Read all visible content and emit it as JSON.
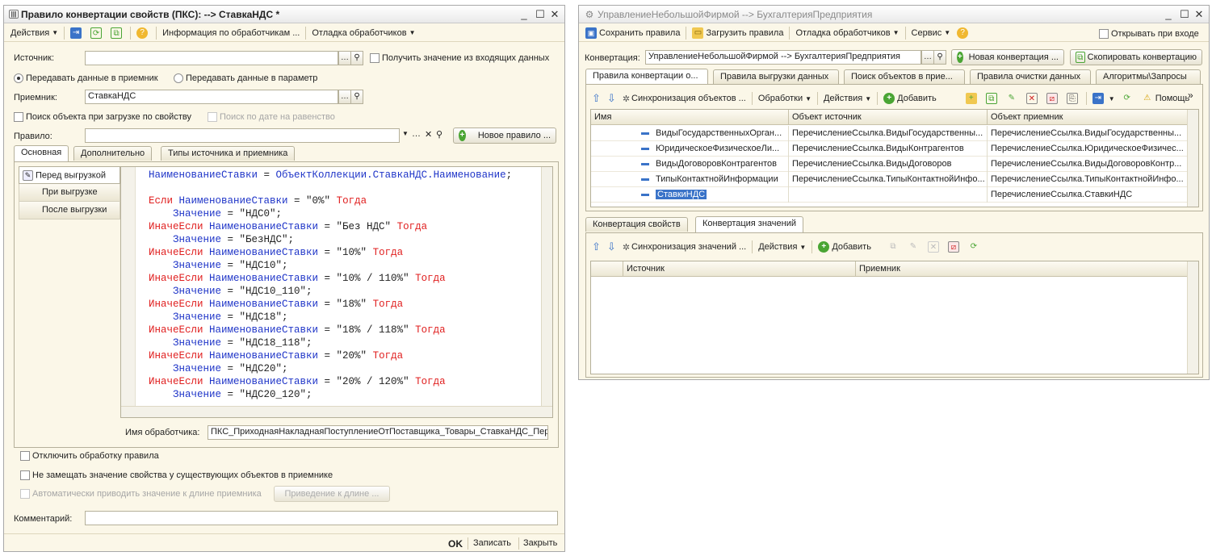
{
  "left_window": {
    "title": "Правило конвертации свойств (ПКС): --> СтавкаНДС *",
    "toolbar": {
      "actions": "Действия",
      "handlers_info": "Информация по обработчикам ...",
      "debug_handlers": "Отладка обработчиков"
    },
    "source": {
      "label": "Источник:",
      "value": ""
    },
    "get_value_incoming": "Получить значение из входящих данных",
    "radio_receiver": "Передавать данные в приемник",
    "radio_param": "Передавать данные в параметр",
    "receiver": {
      "label": "Приемник:",
      "value": "СтавкаНДС"
    },
    "search_object": "Поиск объекта при загрузке по свойству",
    "search_date": "Поиск по дате на равенство",
    "rule": {
      "label": "Правило:",
      "value": ""
    },
    "new_rule": "Новое правило ...",
    "tabs": [
      "Основная",
      "Дополнительно",
      "Типы источника и приемника"
    ],
    "handlers": [
      "Перед выгрузкой",
      "При выгрузке",
      "После выгрузки"
    ],
    "code_lines": [
      [
        {
          "t": "id",
          "v": "НаименованиеСтавки"
        },
        {
          "t": "tx",
          "v": " = "
        },
        {
          "t": "id",
          "v": "ОбъектКоллекции.СтавкаНДС.Наименование"
        },
        {
          "t": "tx",
          "v": ";"
        }
      ],
      [],
      [
        {
          "t": "kw",
          "v": "Если "
        },
        {
          "t": "id",
          "v": "НаименованиеСтавки"
        },
        {
          "t": "tx",
          "v": " = \"0%\" "
        },
        {
          "t": "kw",
          "v": "Тогда"
        }
      ],
      [
        {
          "t": "tx",
          "v": "    "
        },
        {
          "t": "id",
          "v": "Значение"
        },
        {
          "t": "tx",
          "v": " = \"НДС0\";"
        }
      ],
      [
        {
          "t": "kw",
          "v": "ИначеЕсли "
        },
        {
          "t": "id",
          "v": "НаименованиеСтавки"
        },
        {
          "t": "tx",
          "v": " = \"Без НДС\" "
        },
        {
          "t": "kw",
          "v": "Тогда"
        }
      ],
      [
        {
          "t": "tx",
          "v": "    "
        },
        {
          "t": "id",
          "v": "Значение"
        },
        {
          "t": "tx",
          "v": " = \"БезНДС\";"
        }
      ],
      [
        {
          "t": "kw",
          "v": "ИначеЕсли "
        },
        {
          "t": "id",
          "v": "НаименованиеСтавки"
        },
        {
          "t": "tx",
          "v": " = \"10%\" "
        },
        {
          "t": "kw",
          "v": "Тогда"
        }
      ],
      [
        {
          "t": "tx",
          "v": "    "
        },
        {
          "t": "id",
          "v": "Значение"
        },
        {
          "t": "tx",
          "v": " = \"НДС10\";"
        }
      ],
      [
        {
          "t": "kw",
          "v": "ИначеЕсли "
        },
        {
          "t": "id",
          "v": "НаименованиеСтавки"
        },
        {
          "t": "tx",
          "v": " = \"10% / 110%\" "
        },
        {
          "t": "kw",
          "v": "Тогда"
        }
      ],
      [
        {
          "t": "tx",
          "v": "    "
        },
        {
          "t": "id",
          "v": "Значение"
        },
        {
          "t": "tx",
          "v": " = \"НДС10_110\";"
        }
      ],
      [
        {
          "t": "kw",
          "v": "ИначеЕсли "
        },
        {
          "t": "id",
          "v": "НаименованиеСтавки"
        },
        {
          "t": "tx",
          "v": " = \"18%\" "
        },
        {
          "t": "kw",
          "v": "Тогда"
        }
      ],
      [
        {
          "t": "tx",
          "v": "    "
        },
        {
          "t": "id",
          "v": "Значение"
        },
        {
          "t": "tx",
          "v": " = \"НДС18\";"
        }
      ],
      [
        {
          "t": "kw",
          "v": "ИначеЕсли "
        },
        {
          "t": "id",
          "v": "НаименованиеСтавки"
        },
        {
          "t": "tx",
          "v": " = \"18% / 118%\" "
        },
        {
          "t": "kw",
          "v": "Тогда"
        }
      ],
      [
        {
          "t": "tx",
          "v": "    "
        },
        {
          "t": "id",
          "v": "Значение"
        },
        {
          "t": "tx",
          "v": " = \"НДС18_118\";"
        }
      ],
      [
        {
          "t": "kw",
          "v": "ИначеЕсли "
        },
        {
          "t": "id",
          "v": "НаименованиеСтавки"
        },
        {
          "t": "tx",
          "v": " = \"20%\" "
        },
        {
          "t": "kw",
          "v": "Тогда"
        }
      ],
      [
        {
          "t": "tx",
          "v": "    "
        },
        {
          "t": "id",
          "v": "Значение"
        },
        {
          "t": "tx",
          "v": " = \"НДС20\";"
        }
      ],
      [
        {
          "t": "kw",
          "v": "ИначеЕсли "
        },
        {
          "t": "id",
          "v": "НаименованиеСтавки"
        },
        {
          "t": "tx",
          "v": " = \"20% / 120%\" "
        },
        {
          "t": "kw",
          "v": "Тогда"
        }
      ],
      [
        {
          "t": "tx",
          "v": "    "
        },
        {
          "t": "id",
          "v": "Значение"
        },
        {
          "t": "tx",
          "v": " = \"НДС20_120\";"
        }
      ]
    ],
    "handler_name": {
      "label": "Имя обработчика:",
      "value": "ПКС_ПриходнаяНакладнаяПоступлениеОтПоставщика_Товары_СтавкаНДС_Пер"
    },
    "disable_processing": "Отключить обработку правила",
    "no_replace": "Не замещать значение свойства у существующих объектов в приемнике",
    "auto_length": "Автоматически приводить значение к длине приемника",
    "cast_length": "Приведение к длине ...",
    "comment": {
      "label": "Комментарий:",
      "value": ""
    },
    "footer": {
      "ok": "OK",
      "save": "Записать",
      "close": "Закрыть"
    }
  },
  "right_window": {
    "title": "УправлениеНебольшойФирмой --> БухгалтерияПредприятия",
    "toolbar": {
      "save_rules": "Сохранить правила",
      "load_rules": "Загрузить правила",
      "debug_handlers": "Отладка обработчиков",
      "service": "Сервис",
      "open_on_enter": "Открывать при входе"
    },
    "conversion": {
      "label": "Конвертация:",
      "value": "УправлениеНебольшойФирмой --> БухгалтерияПредприятия"
    },
    "new_conversion": "Новая конвертация ...",
    "copy_conversion": "Скопировать конвертацию",
    "tabs": [
      "Правила конвертации о...",
      "Правила выгрузки данных",
      "Поиск объектов в прие...",
      "Правила очистки данных",
      "Алгоритмы\\Запросы"
    ],
    "rules_toolbar": {
      "sync_objects": "Синхронизация объектов ...",
      "processing": "Обработки",
      "actions": "Действия",
      "add": "Добавить",
      "help": "Помощь"
    },
    "rules_grid": {
      "columns": [
        "Имя",
        "Объект источник",
        "Объект приемник"
      ],
      "rows": [
        [
          "ВидыГосударственныхОрган...",
          "ПеречислениеСсылка.ВидыГосударственны...",
          "ПеречислениеСсылка.ВидыГосударственны..."
        ],
        [
          "ЮридическоеФизическоеЛи...",
          "ПеречислениеСсылка.ВидыКонтрагентов",
          "ПеречислениеСсылка.ЮридическоеФизичес..."
        ],
        [
          "ВидыДоговоровКонтрагентов",
          "ПеречислениеСсылка.ВидыДоговоров",
          "ПеречислениеСсылка.ВидыДоговоровКонтр..."
        ],
        [
          "ТипыКонтактнойИнформации",
          "ПеречислениеСсылка.ТипыКонтактнойИнфо...",
          "ПеречислениеСсылка.ТипыКонтактнойИнфо..."
        ],
        [
          "СтавкиНДС",
          "",
          "ПеречислениеСсылка.СтавкиНДС"
        ]
      ]
    },
    "lower_tabs": [
      "Конвертация свойств",
      "Конвертация значений"
    ],
    "values_toolbar": {
      "sync_values": "Синхронизация значений ...",
      "actions": "Действия",
      "add": "Добавить"
    },
    "values_grid": {
      "columns": [
        "Источник",
        "Приемник"
      ]
    }
  }
}
